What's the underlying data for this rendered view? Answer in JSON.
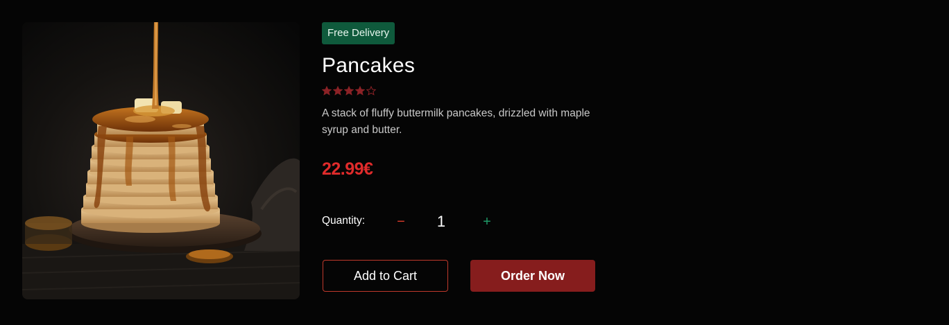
{
  "product": {
    "image_alt": "Stack of pancakes with maple syrup",
    "badge": "Free Delivery",
    "name": "Pancakes",
    "rating": 4,
    "rating_max": 5,
    "description": "A stack of fluffy buttermilk pancakes, drizzled with maple syrup and butter.",
    "price": "22.99€"
  },
  "quantity": {
    "label": "Quantity:",
    "decrement_icon": "−",
    "increment_icon": "+",
    "value": "1"
  },
  "actions": {
    "add_to_cart": "Add to Cart",
    "order_now": "Order Now"
  },
  "colors": {
    "background": "#050505",
    "badge_bg": "#0f5a3c",
    "star": "#8b2226",
    "price": "#e02b2b",
    "minus": "#d83a2a",
    "plus": "#1f9a68",
    "cart_border": "#c0392b",
    "order_bg": "#861d1d"
  }
}
